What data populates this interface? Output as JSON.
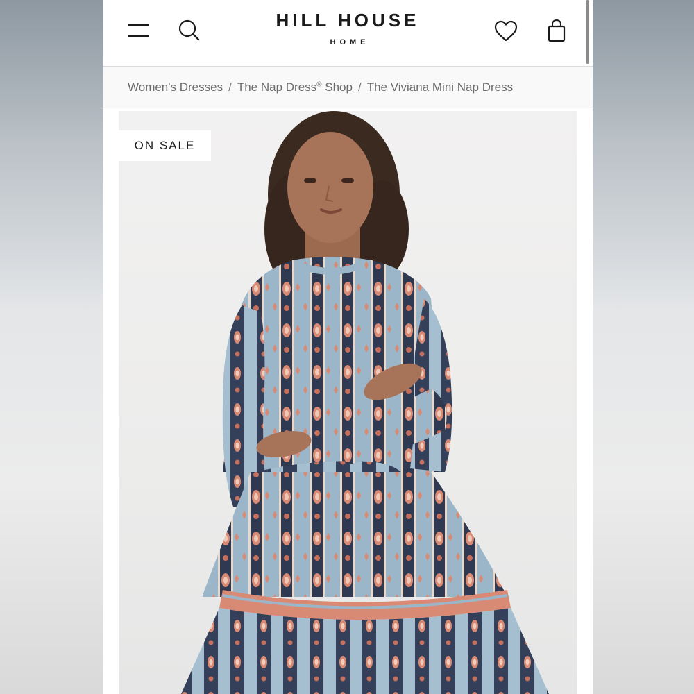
{
  "brand": {
    "name": "HILL HOUSE",
    "subname": "HOME"
  },
  "icons": {
    "menu": "menu-icon",
    "search": "search-icon",
    "wishlist": "heart-icon",
    "bag": "shopping-bag-icon"
  },
  "breadcrumb": {
    "items": [
      "Women's Dresses",
      "The Nap Dress",
      "The Viviana Mini Nap Dress"
    ],
    "registered_mark": "®",
    "item_2_suffix": " Shop",
    "separator": "/"
  },
  "product": {
    "badge": "ON SALE",
    "image_alt": "Model wearing the Viviana Mini Nap Dress in a navy, blue and coral paisley print"
  },
  "colors": {
    "background": "#ffffff",
    "text": "#1a1a1a",
    "breadcrumb_text": "#6b6b6b",
    "dress_navy": "#2f3a52",
    "dress_blue": "#9cb6c9",
    "dress_coral": "#d98a74"
  }
}
